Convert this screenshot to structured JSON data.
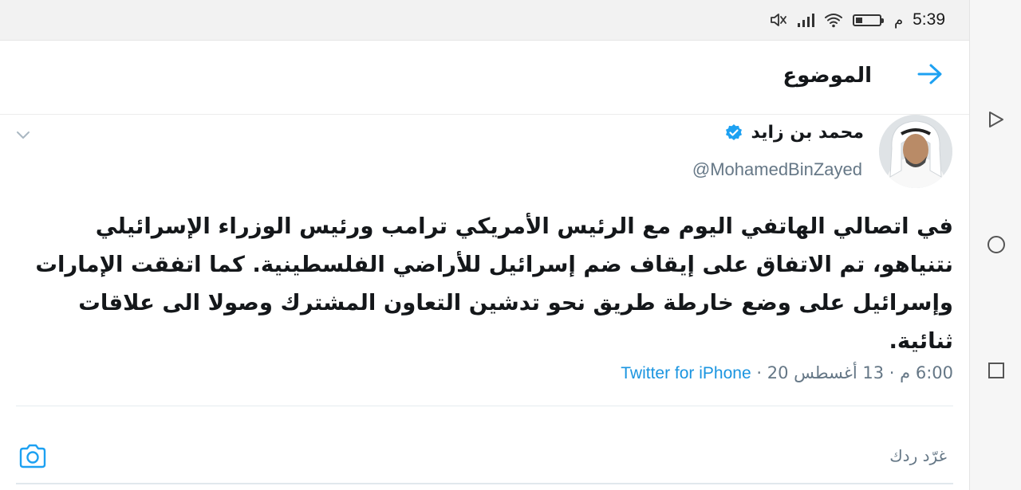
{
  "status_bar": {
    "time": "5:39",
    "ampm": "م",
    "battery_level": 0.3,
    "icons": [
      "mute-icon",
      "signal-icon",
      "wifi-icon",
      "battery-icon"
    ]
  },
  "header": {
    "title": "الموضوع",
    "back_icon": "arrow-right-icon",
    "accent_color": "#1da1f2"
  },
  "tweet": {
    "display_name": "محمد بن زايد",
    "verified": true,
    "handle": "@MohamedBinZayed",
    "text": "في اتصالي الهاتفي اليوم مع الرئيس الأمريكي ترامب ورئيس الوزراء الإسرائيلي نتنياهو، تم الاتفاق على إيقاف ضم إسرائيل للأراضي الفلسطينية. كما اتفقت الإمارات وإسرائيل على وضع خارطة طريق نحو تدشين التعاون المشترك وصولا الى علاقات ثنائية.",
    "meta": {
      "time": "6:00 م",
      "date": "13 أغسطس 20",
      "separator": "·",
      "source": "Twitter for iPhone"
    }
  },
  "reply": {
    "placeholder": "غرّد ردك",
    "camera_icon": "camera-icon"
  },
  "nav_bar": {
    "buttons": [
      "back-triangle-icon",
      "home-circle-icon",
      "recents-square-icon"
    ]
  }
}
